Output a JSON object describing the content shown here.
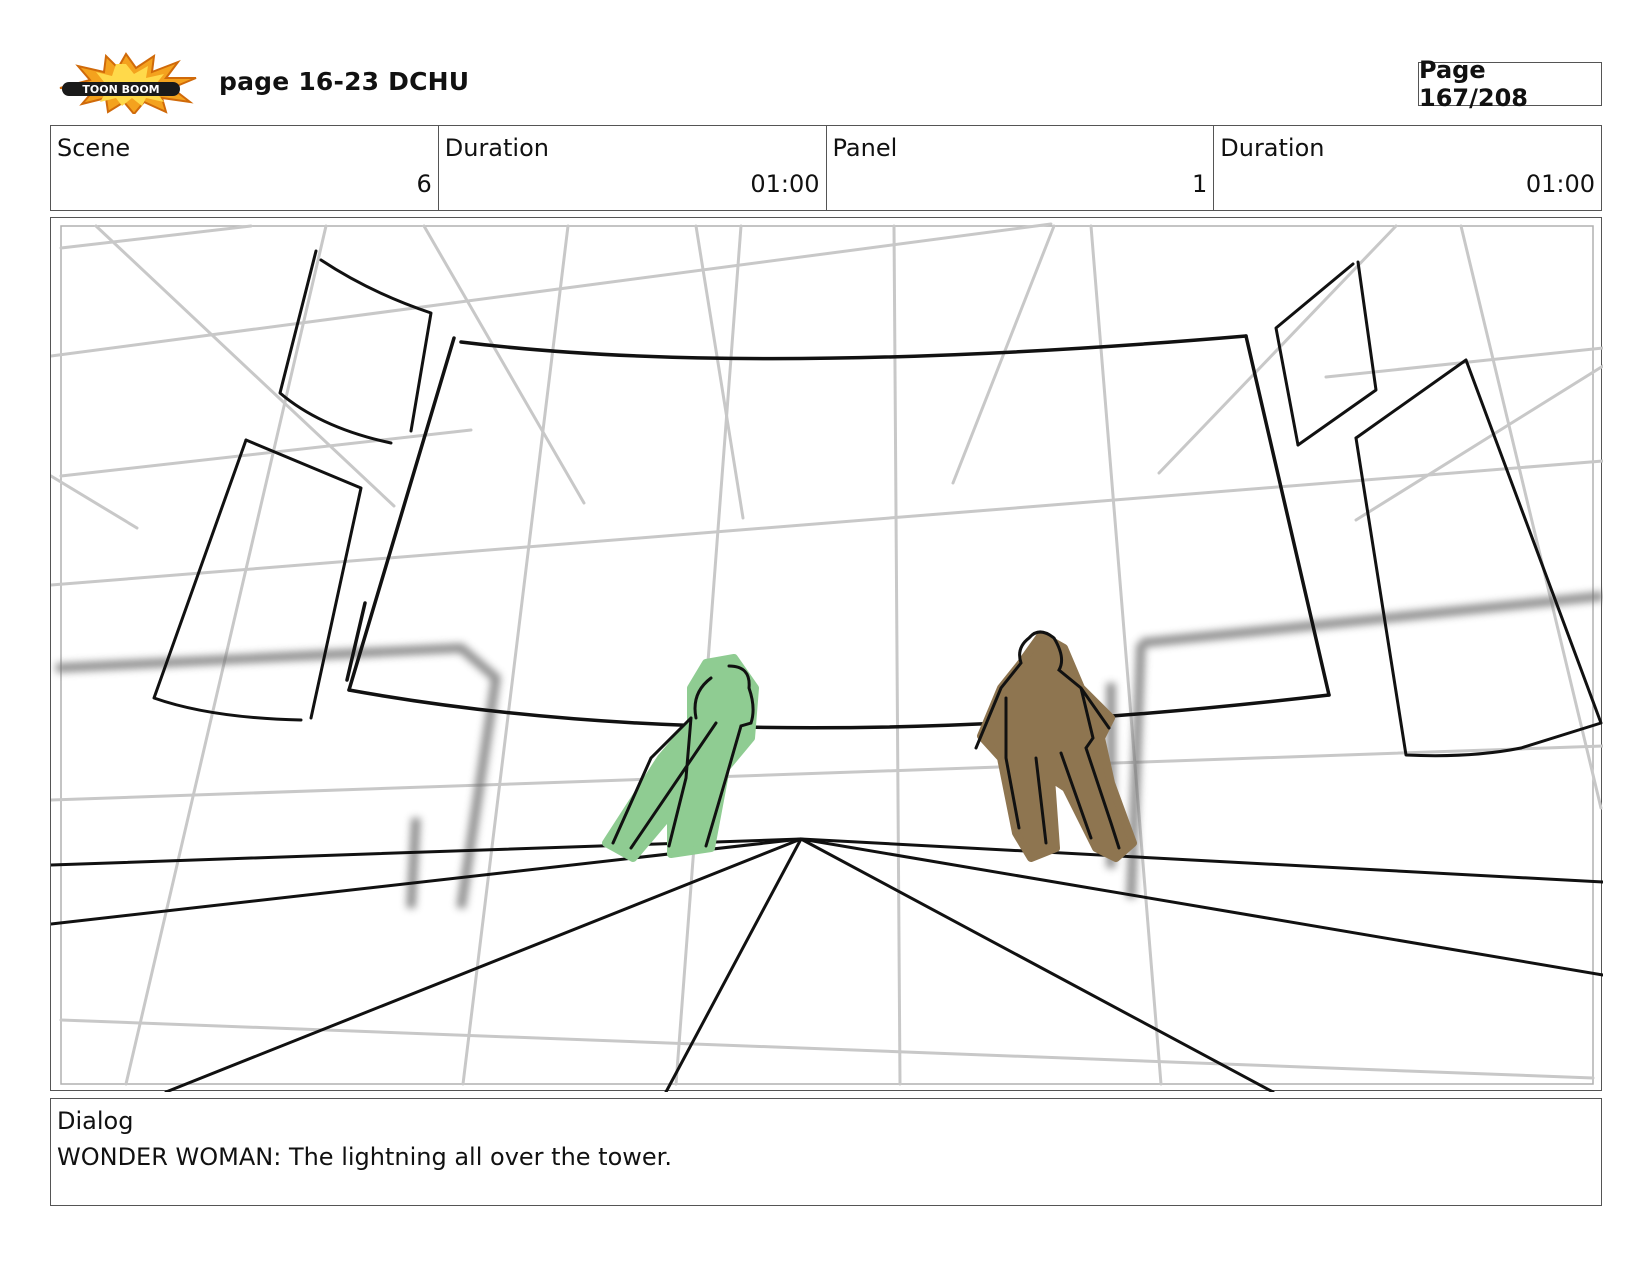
{
  "header": {
    "logo_text": "TOON BOOM",
    "title": "page 16-23 DCHU",
    "page_number": "Page 167/208"
  },
  "info": {
    "scene_label": "Scene",
    "scene_value": "6",
    "scene_duration_label": "Duration",
    "scene_duration_value": "01:00",
    "panel_label": "Panel",
    "panel_value": "1",
    "panel_duration_label": "Duration",
    "panel_duration_value": "01:00"
  },
  "dialog": {
    "label": "Dialog",
    "text": "WONDER WOMAN: The lightning all over the tower."
  },
  "colors": {
    "green_figure": "#8fcc92",
    "brown_figure": "#8e7550",
    "guide_lines": "#c8c8c8"
  }
}
